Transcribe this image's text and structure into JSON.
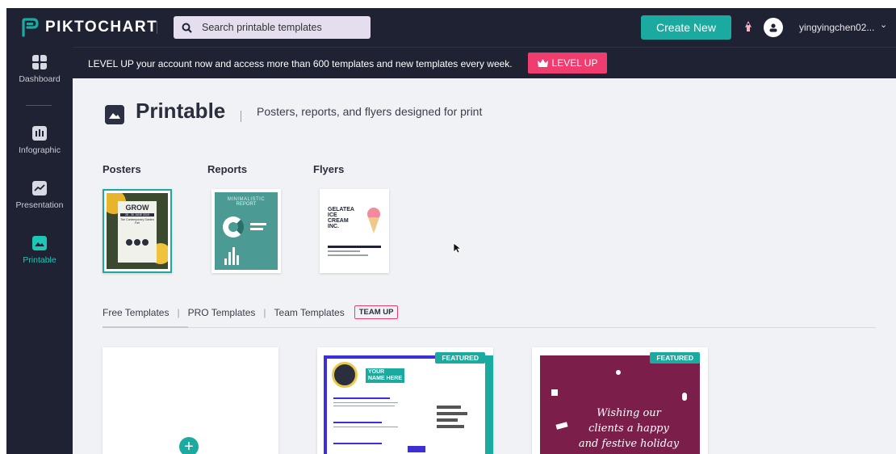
{
  "app": {
    "logo_text": "PIKTOCHART",
    "search_placeholder": "Search printable templates",
    "create_new_label": "Create New",
    "username": "yingyingchen02..."
  },
  "sidebar": {
    "items": [
      {
        "label": "Dashboard",
        "icon": "grid-icon"
      },
      {
        "label": "Infographic",
        "icon": "infographic-icon"
      },
      {
        "label": "Presentation",
        "icon": "chart-line-icon"
      },
      {
        "label": "Printable",
        "icon": "image-icon",
        "active": true
      }
    ]
  },
  "banner": {
    "text": "LEVEL UP your account now and access more than 600 templates and new templates every week.",
    "button_label": "LEVEL UP"
  },
  "page": {
    "title": "Printable",
    "subtitle": "Posters, reports, and flyers designed for print"
  },
  "categories": [
    {
      "label": "Posters",
      "thumb_title": "GROW",
      "thumb_date": "28 - 30 JUNE 2019",
      "thumb_sub": "The Contemporary Garden Fair"
    },
    {
      "label": "Reports",
      "thumb_title": "MINIMALISTIC",
      "thumb_sub": "REPORT"
    },
    {
      "label": "Flyers",
      "thumb_title": "GELATEA",
      "thumb_line2": "ICE",
      "thumb_line3": "CREAM",
      "thumb_line4": "INC."
    }
  ],
  "tabs": {
    "items": [
      "Free Templates",
      "PRO Templates",
      "Team Templates"
    ],
    "badge": "TEAM UP"
  },
  "cards": {
    "featured_label": "FEATURED",
    "resume_name_1": "YOUR",
    "resume_name_2": "NAME HERE",
    "holiday_line1": "Wishing our",
    "holiday_line2": "clients a happy",
    "holiday_line3": "and festive holiday"
  },
  "colors": {
    "nav_bg": "#1f2233",
    "accent_teal": "#1aaa9f",
    "accent_pink": "#ee3d6e",
    "main_bg": "#f1f2f5",
    "holiday_bg": "#7b1e4a",
    "resume_blue": "#3d2fd8"
  }
}
